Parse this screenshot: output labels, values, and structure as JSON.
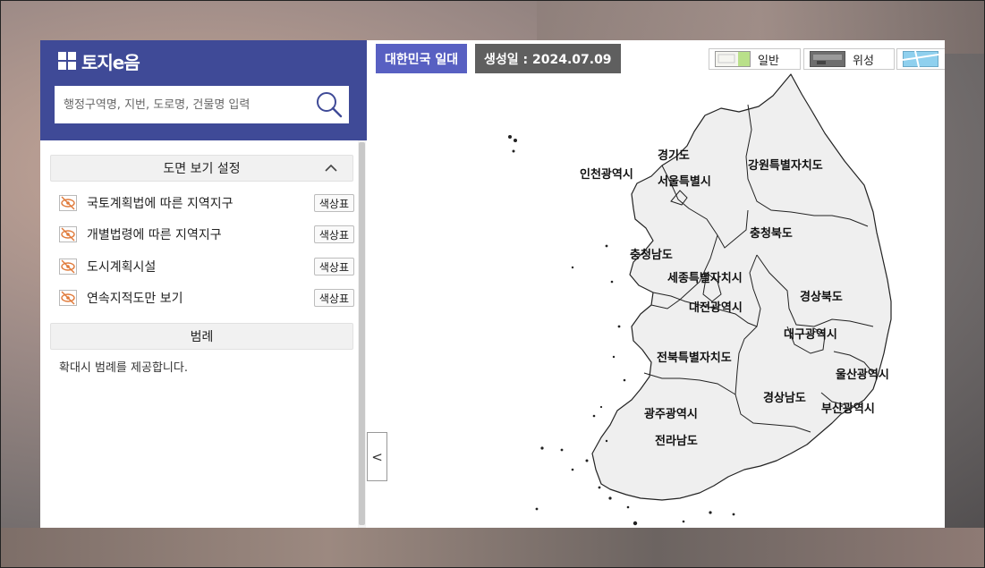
{
  "app": {
    "logo_text": "토지e음"
  },
  "search": {
    "placeholder": "행정구역명, 지번, 도로명, 건물명 입력"
  },
  "sidebar": {
    "view_settings_title": "도면 보기 설정",
    "color_table_label": "색상표",
    "layers": [
      {
        "label": "국토계획법에 따른 지역지구"
      },
      {
        "label": "개별법령에 따른 지역지구"
      },
      {
        "label": "도시계획시설"
      },
      {
        "label": "연속지적도만 보기"
      }
    ],
    "legend_title": "범례",
    "legend_note": "확대시 범례를 제공합니다."
  },
  "map": {
    "area_label": "대한민국 일대",
    "date_label": "생성일 : 2024.07.09",
    "map_types": [
      {
        "label": "일반"
      },
      {
        "label": "위성"
      }
    ],
    "collapse_symbol": "<",
    "regions": [
      {
        "name": "경기도"
      },
      {
        "name": "인천광역시"
      },
      {
        "name": "서울특별시"
      },
      {
        "name": "강원특별자치도"
      },
      {
        "name": "충청남도"
      },
      {
        "name": "충청북도"
      },
      {
        "name": "세종특별자치시"
      },
      {
        "name": "대전광역시"
      },
      {
        "name": "경상북도"
      },
      {
        "name": "대구광역시"
      },
      {
        "name": "전북특별자치도"
      },
      {
        "name": "울산광역시"
      },
      {
        "name": "경상남도"
      },
      {
        "name": "부산광역시"
      },
      {
        "name": "광주광역시"
      },
      {
        "name": "전라남도"
      }
    ]
  },
  "colors": {
    "header": "#3f4a97",
    "area_badge": "#5860c2",
    "date_badge": "#5f5f5f",
    "region_fill": "#efefef"
  }
}
